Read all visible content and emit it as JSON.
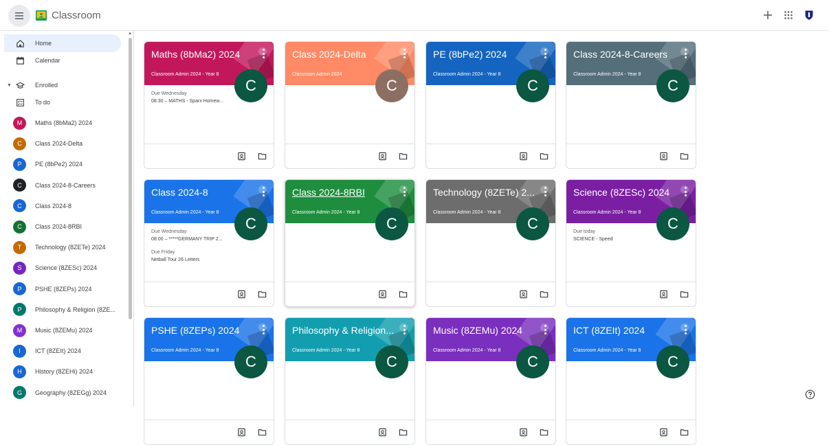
{
  "header": {
    "app_title": "Classroom"
  },
  "sidebar": {
    "home": "Home",
    "calendar": "Calendar",
    "enrolled": "Enrolled",
    "todo": "To do",
    "classes": [
      {
        "label": "Maths (8bMa2) 2024",
        "initial": "M",
        "color": "#c2185b"
      },
      {
        "label": "Class 2024-Delta",
        "initial": "C",
        "color": "#c36b00"
      },
      {
        "label": "PE (8bPe2) 2024",
        "initial": "P",
        "color": "#1967d2"
      },
      {
        "label": "Class 2024-8-Careers",
        "initial": "C",
        "color": "#202124"
      },
      {
        "label": "Class 2024-8",
        "initial": "C",
        "color": "#1967d2"
      },
      {
        "label": "Class 2024-8RBI",
        "initial": "C",
        "color": "#137333"
      },
      {
        "label": "Technology (8ZETe) 2024",
        "initial": "T",
        "color": "#c36b00"
      },
      {
        "label": "Science (8ZESc) 2024",
        "initial": "S",
        "color": "#7627bb"
      },
      {
        "label": "PSHE (8ZEPs) 2024",
        "initial": "P",
        "color": "#1967d2"
      },
      {
        "label": "Philosophy & Religion (8ZE...",
        "initial": "P",
        "color": "#00796b"
      },
      {
        "label": "Music (8ZEMu) 2024",
        "initial": "M",
        "color": "#8430ce"
      },
      {
        "label": "ICT (8ZEIt) 2024",
        "initial": "I",
        "color": "#1967d2"
      },
      {
        "label": "History (8ZEHi) 2024",
        "initial": "H",
        "color": "#1967d2"
      },
      {
        "label": "Geography (8ZEGg) 2024",
        "initial": "G",
        "color": "#00796b"
      }
    ]
  },
  "cards": [
    {
      "title": "Maths (8bMa2) 2024",
      "subtitle": "Classroom Admin 2024 - Year 8",
      "avatar": "C",
      "avatar_color": "#0b5741",
      "banner": "#c2185b",
      "due": [
        {
          "label": "Due Wednesday",
          "text": "08:30 – MATHS - Sparx Homew..."
        }
      ]
    },
    {
      "title": "Class 2024-Delta",
      "subtitle": "Classroom Admin 2024",
      "avatar": "C",
      "avatar_color": "#8d6e63",
      "banner": "#ff8a65",
      "due": []
    },
    {
      "title": "PE (8bPe2) 2024",
      "subtitle": "Classroom Admin 2024 - Year 8",
      "avatar": "C",
      "avatar_color": "#0b5741",
      "banner": "#1565c0",
      "due": []
    },
    {
      "title": "Class 2024-8-Careers",
      "subtitle": "Classroom Admin 2024 - Year 8",
      "avatar": "C",
      "avatar_color": "#0b5741",
      "banner": "#546e7a",
      "due": []
    },
    {
      "title": "Class 2024-8",
      "subtitle": "Classroom Admin 2024 - Year 8",
      "avatar": "C",
      "avatar_color": "#0b5741",
      "banner": "#1a73e8",
      "due": [
        {
          "label": "Due Wednesday",
          "text": "08:00 – *****GERMANY TRIP 2..."
        },
        {
          "label": "Due Friday",
          "text": "Netball Tour 26 Letters"
        }
      ]
    },
    {
      "title": "Class 2024-8RBI",
      "subtitle": "Classroom Admin 2024 - Year 8",
      "avatar": "C",
      "avatar_color": "#0b5741",
      "banner": "#1e8e3e",
      "due": []
    },
    {
      "title": "Technology (8ZETe) 2...",
      "subtitle": "Classroom Admin 2024 - Year 8",
      "avatar": "C",
      "avatar_color": "#0b5741",
      "banner": "#6d6d6d",
      "due": []
    },
    {
      "title": "Science (8ZESc) 2024",
      "subtitle": "Classroom Admin 2024 - Year 8",
      "avatar": "C",
      "avatar_color": "#0b5741",
      "banner": "#7b1fa2",
      "due": [
        {
          "label": "Due today",
          "text": "SCIENCE - Speed"
        }
      ]
    },
    {
      "title": "PSHE (8ZEPs) 2024",
      "subtitle": "Classroom Admin 2024 - Year 8",
      "avatar": "C",
      "avatar_color": "#0b5741",
      "banner": "#1a73e8",
      "due": []
    },
    {
      "title": "Philosophy & Religion...",
      "subtitle": "Classroom Admin 2024 - Year 8",
      "avatar": "C",
      "avatar_color": "#0b5741",
      "banner": "#129eaf",
      "due": []
    },
    {
      "title": "Music (8ZEMu) 2024",
      "subtitle": "Classroom Admin 2024 - Year 8",
      "avatar": "C",
      "avatar_color": "#0b5741",
      "banner": "#7b2fbe",
      "due": []
    },
    {
      "title": "ICT (8ZEIt) 2024",
      "subtitle": "Classroom Admin 2024 - Year 8",
      "avatar": "C",
      "avatar_color": "#0b5741",
      "banner": "#1a73e8",
      "due": []
    }
  ]
}
